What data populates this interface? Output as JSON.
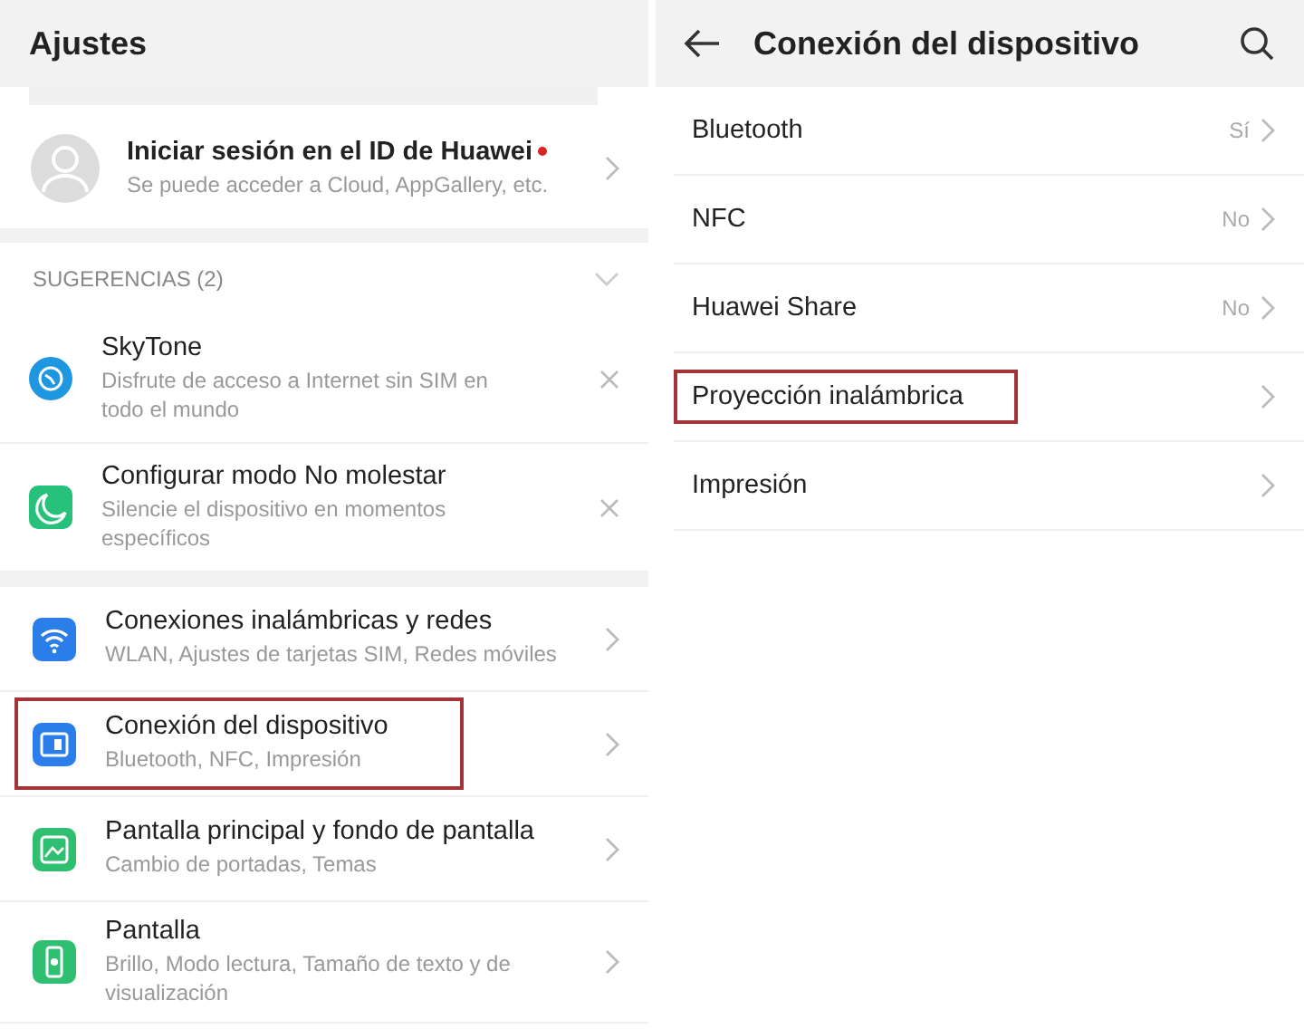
{
  "left": {
    "title": "Ajustes",
    "account": {
      "title": "Iniciar sesión en el ID de Huawei",
      "subtitle": "Se puede acceder a Cloud, AppGallery, etc.",
      "badge": true
    },
    "suggestions": {
      "header": "SUGERENCIAS (2)",
      "expanded": true,
      "items": [
        {
          "kind": "skytone",
          "title": "SkyTone",
          "subtitle": "Disfrute de acceso a Internet sin SIM en todo el mundo"
        },
        {
          "kind": "moon",
          "title": "Configurar modo No molestar",
          "subtitle": "Silencie el dispositivo en momentos específicos"
        }
      ]
    },
    "items": [
      {
        "kind": "wifi",
        "title": "Conexiones inalámbricas y redes",
        "subtitle": "WLAN, Ajustes de tarjetas SIM, Redes móviles",
        "highlighted": false
      },
      {
        "kind": "device",
        "title": "Conexión del dispositivo",
        "subtitle": "Bluetooth, NFC, Impresión",
        "highlighted": true
      },
      {
        "kind": "wallpaper",
        "title": "Pantalla principal y fondo de pantalla",
        "subtitle": "Cambio de portadas, Temas",
        "highlighted": false
      },
      {
        "kind": "display",
        "title": "Pantalla",
        "subtitle": "Brillo, Modo lectura, Tamaño de texto y de visualización",
        "highlighted": false
      }
    ]
  },
  "right": {
    "title": "Conexión del dispositivo",
    "items": [
      {
        "label": "Bluetooth",
        "value": "Sí",
        "highlighted": false
      },
      {
        "label": "NFC",
        "value": "No",
        "highlighted": false
      },
      {
        "label": "Huawei Share",
        "value": "No",
        "highlighted": false
      },
      {
        "label": "Proyección inalámbrica",
        "highlighted": true
      },
      {
        "label": "Impresión",
        "highlighted": false
      }
    ]
  }
}
